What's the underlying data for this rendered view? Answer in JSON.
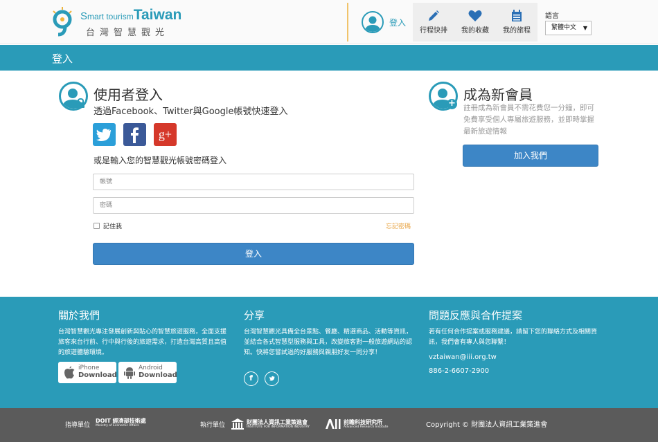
{
  "header": {
    "logo_en": {
      "s": "S",
      "mart": "mart tourism",
      "taiwan": "Taiwan"
    },
    "logo_zh": "台灣智慧觀光",
    "login_label": "登入",
    "nav": [
      {
        "label": "行程快排",
        "icon": "pencil-icon"
      },
      {
        "label": "我的收藏",
        "icon": "heart-icon"
      },
      {
        "label": "我的旅程",
        "icon": "calendar-icon"
      }
    ],
    "language_label": "語言",
    "language_value": "繁體中文"
  },
  "title_bar": "登入",
  "login": {
    "title": "使用者登入",
    "social_prompt": "透過Facebook、Twitter與Google帳號快速登入",
    "social_gplus_text": "g+",
    "alt_prompt": "或是輸入您的智慧觀光帳號密碼登入",
    "account_placeholder": "帳號",
    "password_placeholder": "密碼",
    "remember_label": "記住我",
    "forgot_label": "忘記密碼",
    "submit_label": "登入"
  },
  "register": {
    "title": "成為新會員",
    "description": "註冊成為新會員不需花費您一分鐘，即可免費享受個人專屬旅遊服務，並即時掌握最新旅遊情報",
    "join_label": "加入我們"
  },
  "footer": {
    "about_title": "關於我們",
    "about_text": "台灣智慧觀光專注發展創新與貼心的智慧旅遊服務，全面支援旅客來台行前、行中與行後的旅遊需求，打造台灣高質且高值的旅遊體驗環境。",
    "iphone": {
      "line1": "iPhone",
      "line2": "Download"
    },
    "android": {
      "line1": "Android",
      "line2": "Download"
    },
    "share_title": "分享",
    "share_text": "台灣智慧觀光具備全台景點、餐廳、精選商品、活動等資訊，並結合各式智慧型服務與工具，改變旅客對一般旅遊網站的認知。快將您嘗試過的好服務與親朋好友一同分享！",
    "feedback_title": "問題反應與合作提案",
    "feedback_text": "若有任何合作提案或服務建議，請留下您的聯絡方式及相關資訊，我們會有專人與您聯繫！",
    "email": "vztaiwan@iii.org.tw",
    "phone": "886-2-6607-2900"
  },
  "bottom": {
    "guide_label": "指導單位",
    "exec_label": "執行單位",
    "doit_main": "DOIT 經濟部技術處",
    "doit_sub": "Ministry of Economic Affairs",
    "iii_main": "財團法人資訊工業策進會",
    "iii_sub": "INSTITUTE FOR INFORMATION INDUSTRY",
    "ari_main": "前瞻科技研究所",
    "ari_sub": "Advanced Research Institute",
    "copyright": "Copyright © 財團法人資訊工業策進會"
  },
  "colors": {
    "accent": "#2a9bb8",
    "button": "#3d86c6",
    "footer_bottom": "#5b5b5b",
    "forgot": "#e8a546"
  }
}
